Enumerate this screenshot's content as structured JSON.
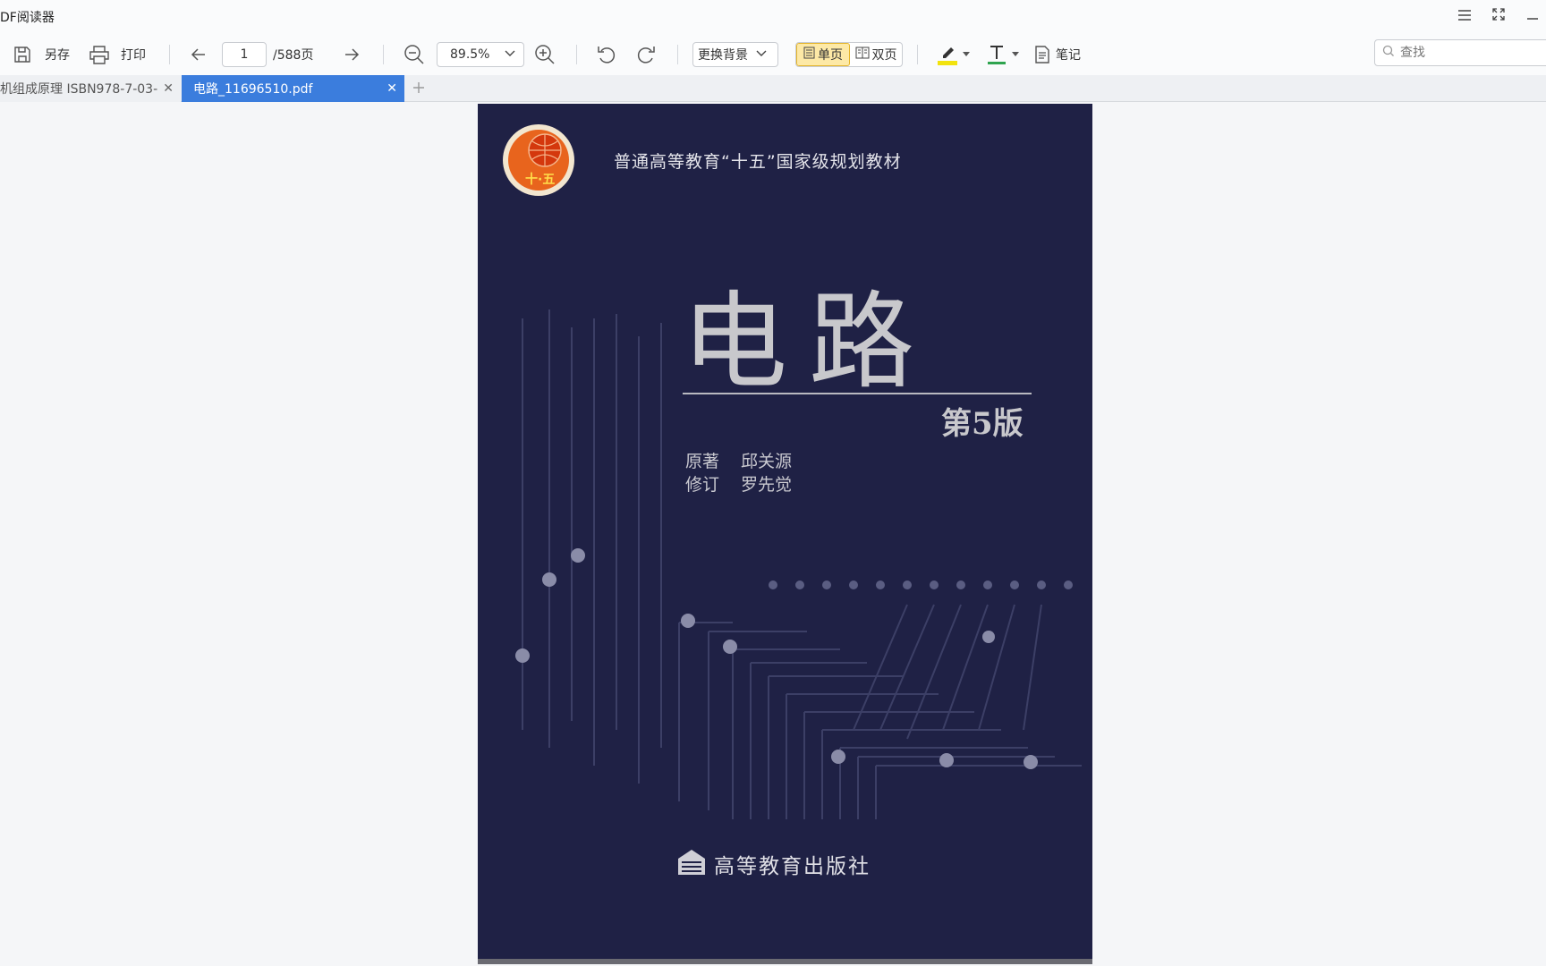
{
  "app": {
    "title": "DF阅读器"
  },
  "toolbar": {
    "save_as": "另存",
    "print": "打印",
    "page_current": "1",
    "page_total": "/588页",
    "zoom": "89.5%",
    "background": "更换背景",
    "single_page": "单页",
    "double_page": "双页",
    "notes": "笔记",
    "highlight_color": "#f2e30e",
    "underline_color": "#2fa44f",
    "search_placeholder": "查找"
  },
  "tabs": [
    {
      "label": "机组成原理 ISBN978-7-03-",
      "active": false
    },
    {
      "label": "电路_11696510.pdf",
      "active": true
    }
  ],
  "document": {
    "subtitle": "普通高等教育“十五”国家级规划教材",
    "title": "电路",
    "edition": "第5版",
    "author_role": "原著",
    "author_name": "邱关源",
    "reviser_role": "修订",
    "reviser_name": "罗先觉",
    "publisher": "高等教育出版社",
    "logo_text": "十·五"
  },
  "colors": {
    "accent": "#3b7ddd",
    "cover_background": "#1f2145",
    "active_view": "#fde9a6"
  }
}
